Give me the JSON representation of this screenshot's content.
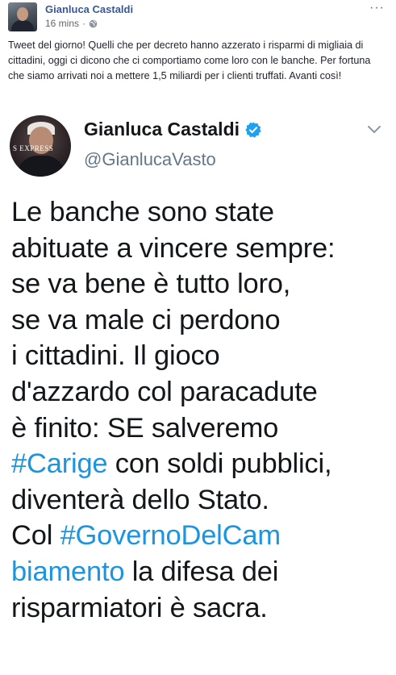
{
  "post": {
    "author": "Gianluca Castaldi",
    "time": "16 mins",
    "separator": "·",
    "text": "Tweet del giorno! Quelli che per decreto hanno azzerato i risparmi di migliaia di cittadini, oggi ci dicono che ci comportiamo come loro con le banche. Per fortuna che siamo arrivati noi a mettere 1,5 miliardi per i clienti truffati. Avanti così!",
    "more_icon": "more-icon"
  },
  "tweet": {
    "name": "Gianluca Castaldi",
    "handle": "@GianlucaVasto",
    "avatar_brand": "S EXPRESS",
    "verified_color": "#1da1f2",
    "hashtag_color": "#1b95e0",
    "lines": {
      "l1": "Le banche sono state",
      "l2": "abituate a vincere sempre:",
      "l3": "se va bene è tutto loro,",
      "l4": "se va male ci perdono",
      "l5": "i cittadini. Il gioco",
      "l6": "d'azzardo col paracadute",
      "l7": "è finito: SE salveremo",
      "l8_tag": "#Carige",
      "l8_rest": " con soldi pubblici,",
      "l9": "diventerà dello Stato.",
      "l10_pre": "Col ",
      "l10_tag": "#GovernoDelCam",
      "l11_tag": "biamento",
      "l11_rest": " la difesa dei",
      "l12": "risparmiatori è sacra."
    }
  }
}
